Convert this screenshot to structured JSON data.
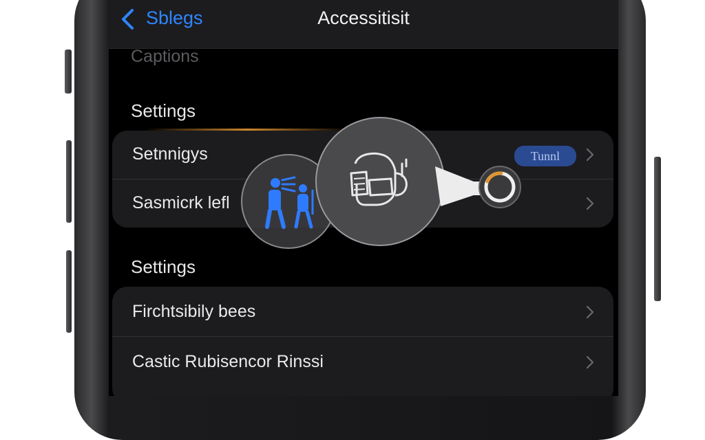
{
  "nav": {
    "back_label": "Sblegs",
    "title": "Accessitisit"
  },
  "scroll_label": "Captions",
  "sections": [
    {
      "header": "Settings",
      "rows": [
        {
          "label": "Setnnigys",
          "badge": "Tunnl"
        },
        {
          "label": "Sasmicrk lefl"
        }
      ]
    },
    {
      "header": "Settings",
      "rows": [
        {
          "label": "Firchtsibily bees"
        },
        {
          "label": "Castic Rubisencor Rinssi"
        }
      ]
    }
  ],
  "colors": {
    "accent": "#2f86ff",
    "badge": "#2a4a92",
    "glow": "#e0962f"
  },
  "icons": [
    "back-chevron-icon",
    "chevron-right-icon",
    "accessibility-people-icon",
    "hand-gesture-icon",
    "pointer-arrow-icon",
    "ring-toggle-icon"
  ]
}
